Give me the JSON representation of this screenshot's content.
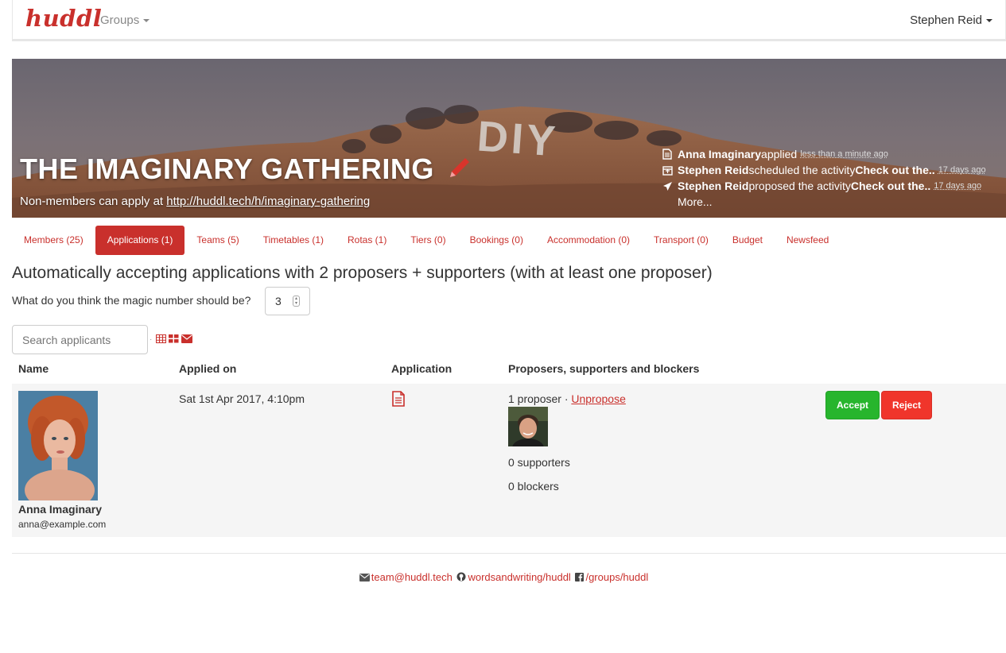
{
  "navbar": {
    "brand": "huddl",
    "groups_label": "Groups",
    "user_label": "Stephen Reid"
  },
  "banner": {
    "title": "THE IMAGINARY GATHERING",
    "subtitle_prefix": "Non-members can apply at ",
    "subtitle_link": "http://huddl.tech/h/imaginary-gathering",
    "feed": [
      {
        "icon": "file-icon",
        "actor": "Anna Imaginary",
        "text": " applied",
        "object": "",
        "ago": "less than a minute ago"
      },
      {
        "icon": "calendar-icon",
        "actor": "Stephen Reid",
        "text": " scheduled the activity ",
        "object": "Check out the..",
        "ago": "17 days ago"
      },
      {
        "icon": "send-icon",
        "actor": "Stephen Reid",
        "text": " proposed the activity ",
        "object": "Check out the..",
        "ago": "17 days ago"
      }
    ],
    "more_label": "More..."
  },
  "tabs": [
    {
      "label": "Members (25)",
      "active": false
    },
    {
      "label": "Applications (1)",
      "active": true
    },
    {
      "label": "Teams (5)",
      "active": false
    },
    {
      "label": "Timetables (1)",
      "active": false
    },
    {
      "label": "Rotas (1)",
      "active": false
    },
    {
      "label": "Tiers (0)",
      "active": false
    },
    {
      "label": "Bookings (0)",
      "active": false
    },
    {
      "label": "Accommodation (0)",
      "active": false
    },
    {
      "label": "Transport (0)",
      "active": false
    },
    {
      "label": "Budget",
      "active": false
    },
    {
      "label": "Newsfeed",
      "active": false
    }
  ],
  "applications": {
    "heading": "Automatically accepting applications with 2 proposers + supporters (with at least one proposer)",
    "magic_question": "What do you think the magic number should be?",
    "magic_value": "3",
    "search_placeholder": "Search applicants",
    "columns": {
      "name": "Name",
      "applied_on": "Applied on",
      "application": "Application",
      "proposers": "Proposers, supporters and blockers"
    },
    "rows": [
      {
        "name": "Anna Imaginary",
        "email": "anna@example.com",
        "applied_on": "Sat 1st Apr 2017, 4:10pm",
        "proposers_text": "1 proposer · ",
        "unpropose_label": "Unpropose",
        "supporters": "0 supporters",
        "blockers": "0 blockers",
        "accept_label": "Accept",
        "reject_label": "Reject"
      }
    ]
  },
  "footer": {
    "email": "team@huddl.tech",
    "github": "wordsandwriting/huddl",
    "facebook": "/groups/huddl"
  },
  "colors": {
    "brand": "#c9302c",
    "accept": "#27b52d",
    "reject": "#f0352b"
  }
}
